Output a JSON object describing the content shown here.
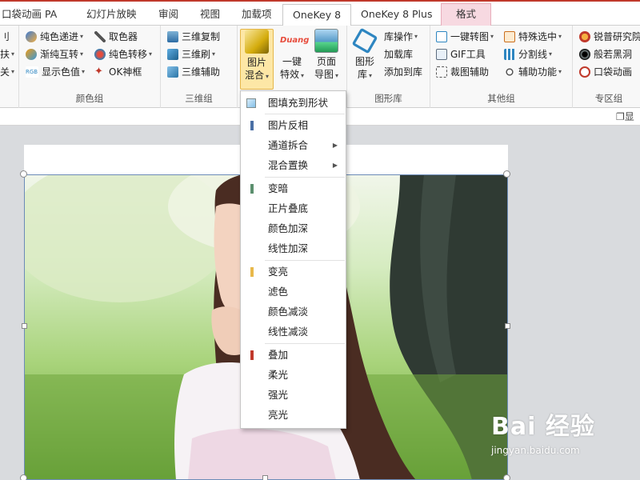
{
  "tabs": {
    "pocket": "口袋动画 PA",
    "slideshow": "幻灯片放映",
    "review": "审阅",
    "view": "视图",
    "addins": "加载项",
    "onekey8": "OneKey 8",
    "onekey8plus": "OneKey 8 Plus",
    "format": "格式"
  },
  "ribbon": {
    "col0": {
      "row1": "刂",
      "row2": "扶",
      "row3": "关"
    },
    "color_group": {
      "label": "颜色组",
      "items": [
        "纯色递进",
        "渐纯互转",
        "显示色值",
        "取色器",
        "纯色转移",
        "OK神框"
      ]
    },
    "three_d_group": {
      "label": "三维组",
      "items": [
        "三维复制",
        "三维刷",
        "三维辅助"
      ]
    },
    "image_group": {
      "blend": "图片\n混合",
      "blend_l1": "图片",
      "blend_l2": "混合",
      "effect_l1": "一键",
      "effect_l2": "特效",
      "duang": "Duang",
      "page_l1": "页面",
      "page_l2": "导图"
    },
    "shape_lib_group": {
      "label": "图形库",
      "big_l1": "图形",
      "big_l2": "库",
      "items": [
        "库操作",
        "加载库",
        "添加到库"
      ]
    },
    "other_group": {
      "label": "其他组",
      "items": [
        "一键转图",
        "GIF工具",
        "裁图辅助",
        "特殊选中",
        "分割线",
        "辅助功能"
      ]
    },
    "special_group": {
      "label": "专区组",
      "items": [
        "锐普研究院",
        "般若黑洞",
        "口袋动画"
      ]
    }
  },
  "subbar": {
    "restore_label": "显"
  },
  "menu": {
    "fill_shape": "图填充到形状",
    "items": [
      {
        "label": "图片反相",
        "color": "#4a6fa5"
      },
      {
        "label": "通道拆合",
        "submenu": true
      },
      {
        "label": "混合置换",
        "submenu": true
      },
      {
        "label": "变暗",
        "color": "#5b8f6e"
      },
      {
        "label": "正片叠底"
      },
      {
        "label": "颜色加深"
      },
      {
        "label": "线性加深"
      },
      {
        "label": "变亮",
        "color": "#e8b84a"
      },
      {
        "label": "滤色"
      },
      {
        "label": "颜色减淡"
      },
      {
        "label": "线性减淡"
      },
      {
        "label": "叠加",
        "color": "#c0392b"
      },
      {
        "label": "柔光"
      },
      {
        "label": "强光"
      },
      {
        "label": "亮光"
      }
    ]
  },
  "watermark": {
    "big": "Bai 经验",
    "small": "jingyan.baidu.com"
  },
  "colors": {
    "accent": "#c0392b",
    "format_tab": "#f7d9e1",
    "selected_btn": "#fde7a6"
  }
}
